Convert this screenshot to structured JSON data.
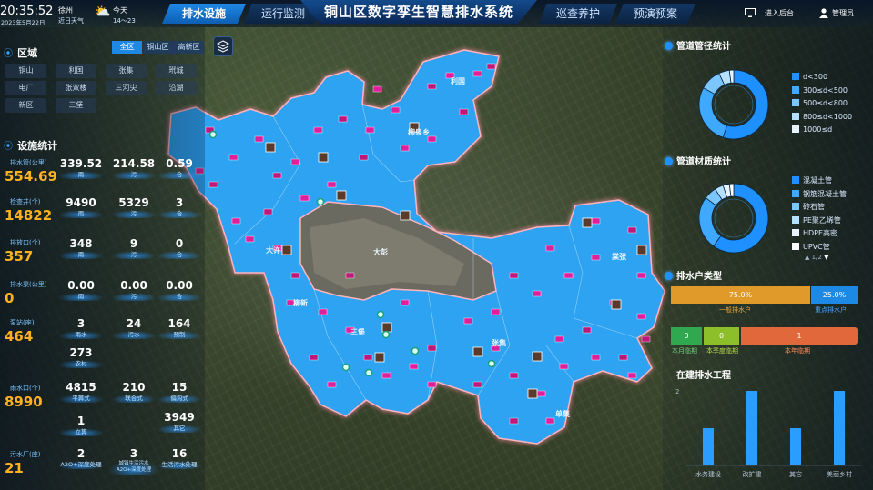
{
  "clock": {
    "time": "20:35:52",
    "date": "2023年5月22日"
  },
  "weather": {
    "city": "徐州",
    "label": "近日天气",
    "today": "今天",
    "temp": "14～23"
  },
  "header": {
    "title": "铜山区数字孪生智慧排水系统",
    "tabs": [
      "排水设施",
      "运行监测",
      "巡查养护",
      "预演预案"
    ],
    "admin_link": "进入后台",
    "user": "管理员"
  },
  "region": {
    "title": "区域",
    "items": [
      "铜山",
      "利国",
      "张集",
      "玳城",
      "电厂",
      "张双楼",
      "三河尖",
      "沿湖",
      "新区",
      "三堡"
    ]
  },
  "region_filter": [
    "全区",
    "铜山区",
    "高新区"
  ],
  "facility_stats": {
    "title": "设施统计",
    "rows": [
      {
        "name": "排水管(公里)",
        "total": "554.69",
        "values": [
          {
            "v": "339.52",
            "l": "雨"
          },
          {
            "v": "214.58",
            "l": "污"
          },
          {
            "v": "0.59",
            "l": "合"
          }
        ]
      },
      {
        "name": "检查井(个)",
        "total": "14822",
        "values": [
          {
            "v": "9490",
            "l": "雨"
          },
          {
            "v": "5329",
            "l": "污"
          },
          {
            "v": "3",
            "l": "合"
          }
        ]
      },
      {
        "name": "排放口(个)",
        "total": "357",
        "values": [
          {
            "v": "348",
            "l": "雨"
          },
          {
            "v": "9",
            "l": "污"
          },
          {
            "v": "0",
            "l": "合"
          }
        ]
      },
      {
        "name": "排水渠(公里)",
        "total": "0",
        "values": [
          {
            "v": "0.00",
            "l": "雨"
          },
          {
            "v": "0.00",
            "l": "污"
          },
          {
            "v": "0.00",
            "l": "合"
          }
        ]
      },
      {
        "name": "泵站(座)",
        "total": "464",
        "values": [
          {
            "v": "3",
            "l": "雨水"
          },
          {
            "v": "24",
            "l": "污水"
          },
          {
            "v": "164",
            "l": "预制"
          },
          {
            "v": "273",
            "l": "农村"
          }
        ]
      },
      {
        "name": "雨水口(个)",
        "total": "8990",
        "values": [
          {
            "v": "4815",
            "l": "平箅式"
          },
          {
            "v": "210",
            "l": "联合式"
          },
          {
            "v": "15",
            "l": "偏沟式"
          },
          {
            "v": "1",
            "l": "立箅"
          },
          {
            "v": "3949",
            "l": "其它"
          }
        ]
      },
      {
        "name": "污水厂(座)",
        "total": "21",
        "values": [
          {
            "v": "2",
            "l": "A2O+深度处理"
          },
          {
            "v": "3",
            "l": "城镇生活污水 A2O+深度处理"
          },
          {
            "v": "16",
            "l": "生活污水处理"
          }
        ]
      }
    ]
  },
  "map_labels": [
    "利国",
    "柳泉乡",
    "大许",
    "柳新",
    "大彭",
    "三堡",
    "张集",
    "单集",
    "棠张"
  ],
  "pipe_diameter": {
    "title": "管道管径统计",
    "legend": [
      "d<300",
      "300≤d<500",
      "500≤d<800",
      "800≤d<1000",
      "1000≤d"
    ],
    "colors": [
      "#1e90ff",
      "#3fa9ff",
      "#7cc6ff",
      "#b6e0ff",
      "#e6f4ff"
    ],
    "chart_data": {
      "type": "pie",
      "categories": [
        "d<300",
        "300≤d<500",
        "500≤d<800",
        "800≤d<1000",
        "1000≤d"
      ],
      "values": [
        55,
        28,
        10,
        5,
        2
      ]
    }
  },
  "pipe_material": {
    "title": "管道材质统计",
    "legend": [
      "混凝土管",
      "钢筋混凝土管",
      "砖石管",
      "PE聚乙烯管",
      "HDPE高密...",
      "UPVC管"
    ],
    "colors": [
      "#1e90ff",
      "#3fa9ff",
      "#7cc6ff",
      "#b6e0ff",
      "#e6f4ff",
      "#ffffff"
    ],
    "page": "1/2",
    "chart_data": {
      "type": "pie",
      "categories": [
        "混凝土管",
        "钢筋混凝土管",
        "砖石管",
        "PE聚乙烯管",
        "HDPE高密...",
        "UPVC管"
      ],
      "values": [
        60,
        25,
        6,
        4,
        3,
        2
      ]
    }
  },
  "drainage_household": {
    "title": "排水户类型",
    "segments": [
      {
        "value": "75.0%",
        "label": "一般排水户",
        "color": "#e09a2a",
        "pct": 75
      },
      {
        "value": "25.0%",
        "label": "重点排水户",
        "color": "#1e88e5",
        "pct": 25
      }
    ],
    "expiry": [
      {
        "value": "0",
        "label": "本月临期",
        "color": "#2fa84f"
      },
      {
        "value": "0",
        "label": "本季度临期",
        "color": "#8dbf2a"
      },
      {
        "value": "1",
        "label": "本年临期",
        "color": "#e0683a"
      }
    ]
  },
  "construction": {
    "title": "在建排水工程",
    "chart_data": {
      "type": "bar",
      "categories": [
        "水务建设",
        "改扩建",
        "其它",
        "美丽乡村"
      ],
      "values": [
        1,
        2,
        1,
        2
      ],
      "ylim": [
        0,
        2
      ]
    },
    "ytick_top": "2"
  }
}
